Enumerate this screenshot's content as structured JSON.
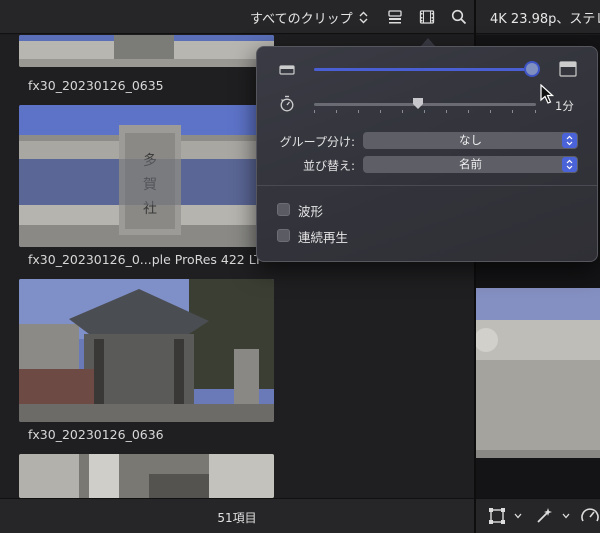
{
  "topbar": {
    "clip_filter": "すべてのクリップ",
    "viewer_info": "4K 23.98p、ステレ"
  },
  "browser": {
    "clips": [
      {
        "name": "fx30_20230126_0635"
      },
      {
        "name": "fx30_20230126_0...ple ProRes 422 LT"
      },
      {
        "name": "fx30_20230126_0636"
      }
    ]
  },
  "popover": {
    "duration_value": "1分",
    "group_label": "グループ分け:",
    "group_value": "なし",
    "sort_label": "並び替え:",
    "sort_value": "名前",
    "waveform_label": "波形",
    "continuous_label": "連続再生",
    "clip_height_level": 0.98,
    "duration_level": 0.47
  },
  "bottombar": {
    "item_count": "51項目"
  },
  "colors": {
    "accent": "#4b63d9",
    "panel": "#1f1f21"
  }
}
